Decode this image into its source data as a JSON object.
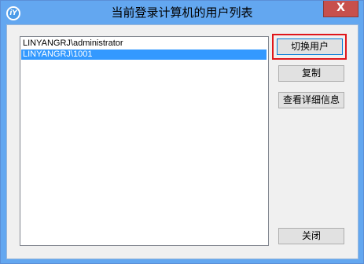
{
  "window": {
    "title": "当前登录计算机的用户列表",
    "close_glyph": "X",
    "icon_glyph": "iY"
  },
  "user_list": {
    "items": [
      {
        "label": "LINYANGRJ\\administrator",
        "selected": false
      },
      {
        "label": "LINYANGRJ\\1001",
        "selected": true
      }
    ]
  },
  "buttons": {
    "switch_user": "切换用户",
    "copy": "复制",
    "view_details": "查看详细信息",
    "close": "关闭"
  },
  "colors": {
    "titlebar": "#63a7f0",
    "selection": "#3399ff",
    "highlight_frame": "#e0161b",
    "close_button": "#c7504c"
  }
}
